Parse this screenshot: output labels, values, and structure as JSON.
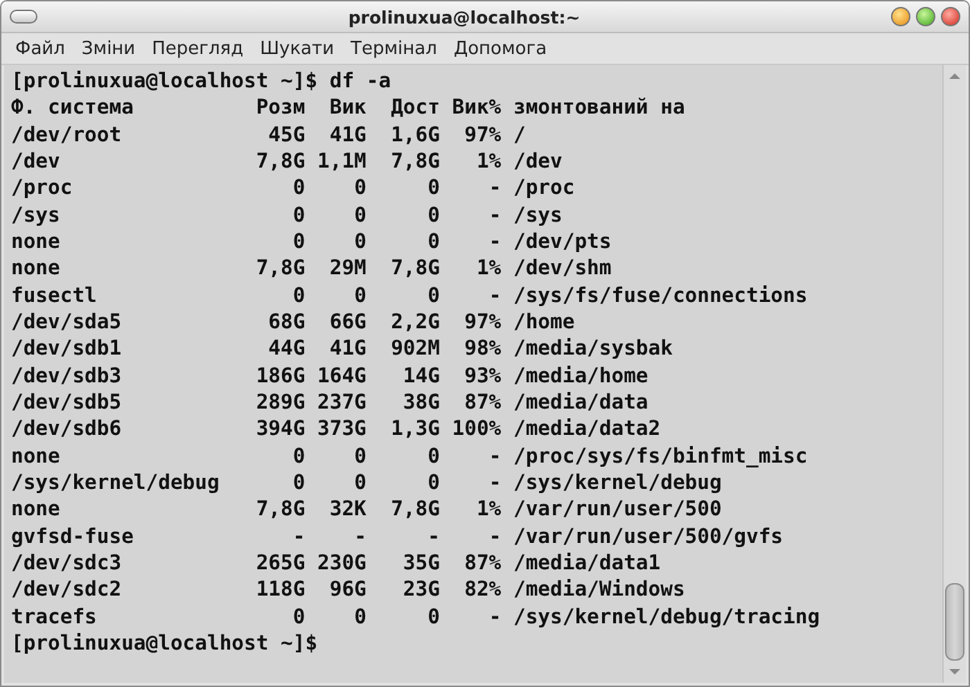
{
  "window": {
    "title": "prolinuxua@localhost:~"
  },
  "menu": [
    "Файл",
    "Зміни",
    "Перегляд",
    "Шукати",
    "Термінал",
    "Допомога"
  ],
  "terminal": {
    "command_line": "[prolinuxua@localhost ~]$ df -a",
    "table": {
      "columns": [
        "Ф. система",
        "Розм",
        "Вик",
        "Дост",
        "Вик%",
        "змонтований на"
      ],
      "rows": [
        [
          "/dev/root",
          "45G",
          "41G",
          "1,6G",
          "97%",
          "/"
        ],
        [
          "/dev",
          "7,8G",
          "1,1M",
          "7,8G",
          "1%",
          "/dev"
        ],
        [
          "/proc",
          "0",
          "0",
          "0",
          "-",
          "/proc"
        ],
        [
          "/sys",
          "0",
          "0",
          "0",
          "-",
          "/sys"
        ],
        [
          "none",
          "0",
          "0",
          "0",
          "-",
          "/dev/pts"
        ],
        [
          "none",
          "7,8G",
          "29M",
          "7,8G",
          "1%",
          "/dev/shm"
        ],
        [
          "fusectl",
          "0",
          "0",
          "0",
          "-",
          "/sys/fs/fuse/connections"
        ],
        [
          "/dev/sda5",
          "68G",
          "66G",
          "2,2G",
          "97%",
          "/home"
        ],
        [
          "/dev/sdb1",
          "44G",
          "41G",
          "902M",
          "98%",
          "/media/sysbak"
        ],
        [
          "/dev/sdb3",
          "186G",
          "164G",
          "14G",
          "93%",
          "/media/home"
        ],
        [
          "/dev/sdb5",
          "289G",
          "237G",
          "38G",
          "87%",
          "/media/data"
        ],
        [
          "/dev/sdb6",
          "394G",
          "373G",
          "1,3G",
          "100%",
          "/media/data2"
        ],
        [
          "none",
          "0",
          "0",
          "0",
          "-",
          "/proc/sys/fs/binfmt_misc"
        ],
        [
          "/sys/kernel/debug",
          "0",
          "0",
          "0",
          "-",
          "/sys/kernel/debug"
        ],
        [
          "none",
          "7,8G",
          "32K",
          "7,8G",
          "1%",
          "/var/run/user/500"
        ],
        [
          "gvfsd-fuse",
          "-",
          "-",
          "-",
          "-",
          "/var/run/user/500/gvfs"
        ],
        [
          "/dev/sdc3",
          "265G",
          "230G",
          "35G",
          "87%",
          "/media/data1"
        ],
        [
          "/dev/sdc2",
          "118G",
          "96G",
          "23G",
          "82%",
          "/media/Windows"
        ],
        [
          "tracefs",
          "0",
          "0",
          "0",
          "-",
          "/sys/kernel/debug/tracing"
        ]
      ]
    },
    "final_prompt": "[prolinuxua@localhost ~]$"
  }
}
